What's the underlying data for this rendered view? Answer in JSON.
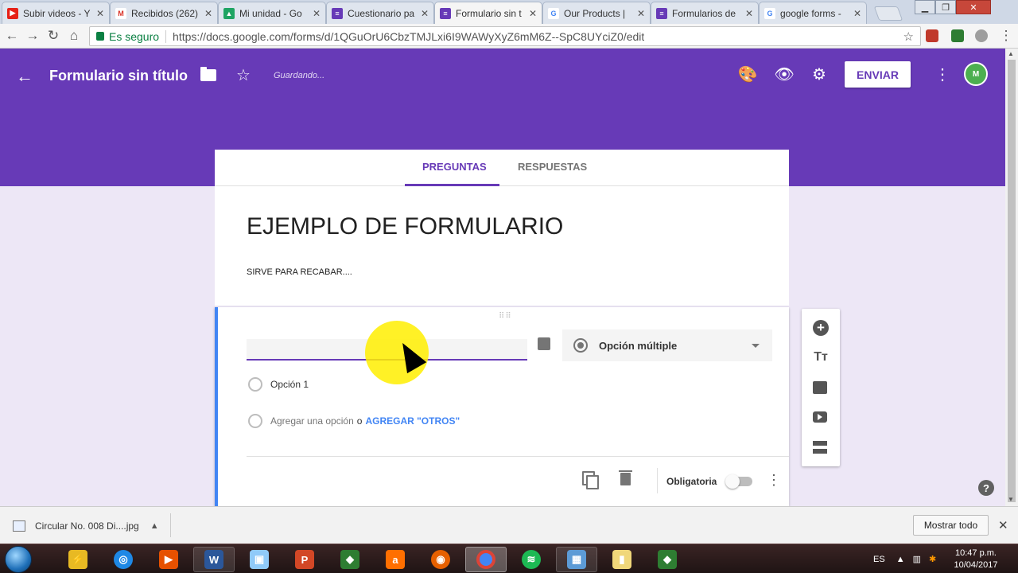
{
  "browser": {
    "tabs": [
      {
        "title": "Subir videos - Y",
        "icon": "youtube-icon",
        "color": "#e62117"
      },
      {
        "title": "Recibidos (262)",
        "icon": "gmail-icon",
        "color": "#d93025"
      },
      {
        "title": "Mi unidad - Go",
        "icon": "drive-icon",
        "color": "#1fa463"
      },
      {
        "title": "Cuestionario pa",
        "icon": "forms-icon",
        "color": "#673ab7"
      },
      {
        "title": "Formulario sin t",
        "icon": "forms-icon",
        "color": "#673ab7"
      },
      {
        "title": "Our Products | ",
        "icon": "google-icon",
        "color": "#4285f4"
      },
      {
        "title": "Formularios de ",
        "icon": "forms-icon",
        "color": "#673ab7"
      },
      {
        "title": "google forms - ",
        "icon": "google-icon",
        "color": "#4285f4"
      }
    ],
    "active_tab": 4,
    "secure_label": "Es seguro",
    "url": "https://docs.google.com/forms/d/1QGuOrU6CbzTMJLxi6I9WAWyXyZ6mM6Z--SpC8UYciZ0/edit"
  },
  "header": {
    "title": "Formulario sin título",
    "saving_status": "Guardando...",
    "send_label": "ENVIAR",
    "avatar_text": "M",
    "accent_color": "#673ab7"
  },
  "form": {
    "tabs": {
      "questions": "PREGUNTAS",
      "responses": "RESPUESTAS"
    },
    "title": "EJEMPLO DE FORMULARIO",
    "description": "SIRVE PARA RECABAR....",
    "question": {
      "input_value": "",
      "type_label": "Opción múltiple",
      "option1": "Opción 1",
      "add_option": "Agregar una opción",
      "or": "o",
      "add_other": "AGREGAR \"OTROS\"",
      "required_label": "Obligatoria",
      "required": false
    }
  },
  "download_bar": {
    "file_name": "Circular No. 008 Di....jpg",
    "show_all": "Mostrar todo"
  },
  "taskbar": {
    "language": "ES",
    "time": "10:47 p.m.",
    "date": "10/04/2017"
  }
}
